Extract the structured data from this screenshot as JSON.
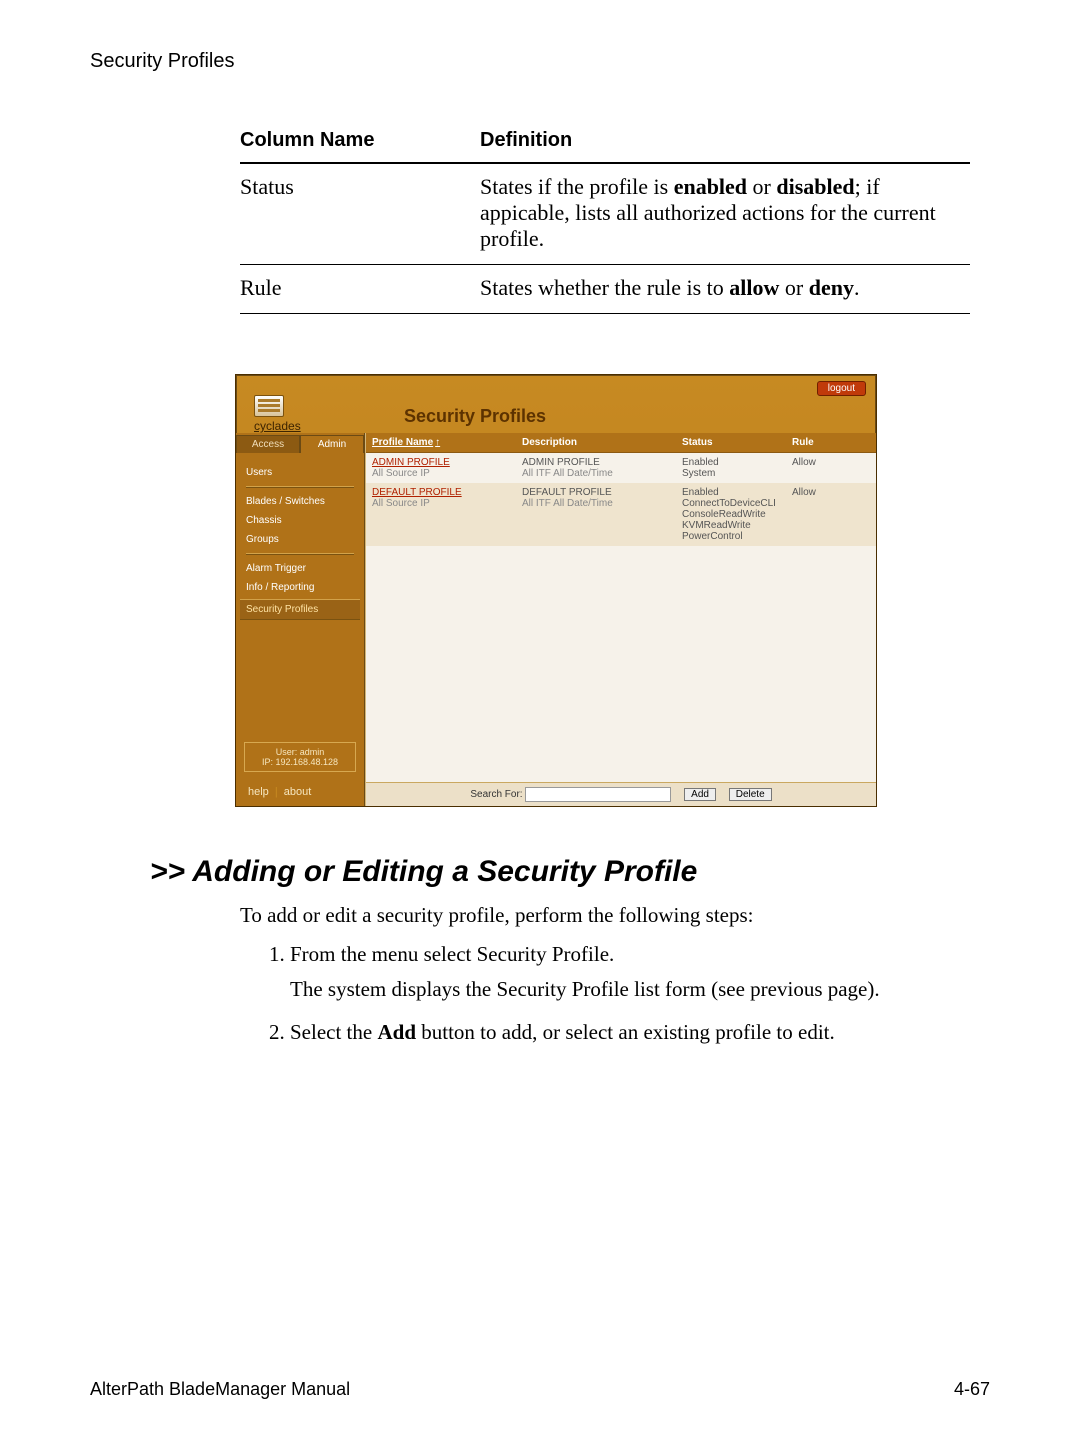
{
  "header": "Security Profiles",
  "def_table": {
    "columns": [
      "Column Name",
      "Definition"
    ],
    "rows": [
      {
        "name": "Status",
        "definition_pre": "States if the profile is ",
        "bold1": "enabled",
        "mid1": " or ",
        "bold2": "disabled",
        "definition_post": "; if appicable, lists all authorized actions for the current profile."
      },
      {
        "name": "Rule",
        "definition_pre": "States whether the rule is to ",
        "bold1": "allow",
        "mid1": " or ",
        "bold2": "deny",
        "definition_post": "."
      }
    ]
  },
  "app": {
    "logo_text": "cyclades",
    "title": "Security Profiles",
    "logout": "logout",
    "tabs": [
      "Access",
      "Admin"
    ],
    "side_items": [
      "Users",
      "Blades / Switches",
      "Chassis",
      "Groups",
      "Alarm Trigger",
      "Info / Reporting",
      "Security Profiles"
    ],
    "userbox_user": "User: admin",
    "userbox_ip": "IP: 192.168.48.128",
    "helpbar_help": "help",
    "helpbar_about": "about",
    "columns": [
      "Profile Name",
      "Description",
      "Status",
      "Rule"
    ],
    "sort_indicator": "↑",
    "rows": [
      {
        "profile_link": "ADMIN PROFILE",
        "profile_sub": "All Source IP",
        "desc_line1": "ADMIN PROFILE",
        "desc_line2": "All ITF      All Date/Time",
        "status": "Enabled\nSystem",
        "rule": "Allow"
      },
      {
        "profile_link": "DEFAULT PROFILE",
        "profile_sub": "All Source IP",
        "desc_line1": "DEFAULT PROFILE",
        "desc_line2": "All ITF      All Date/Time",
        "status": "Enabled\nConnectToDeviceCLI\nConsoleReadWrite\nKVMReadWrite\nPowerControl",
        "rule": "Allow"
      }
    ],
    "search_label": "Search For:",
    "search_value": "",
    "add_btn": "Add",
    "delete_btn": "Delete"
  },
  "section_heading": ">> Adding or Editing a Security Profile",
  "intro_text": "To add or edit a security profile, perform the following steps:",
  "steps": [
    {
      "main": "From the menu select Security Profile.",
      "sub": "The system displays the Security Profile list form (see previous page)."
    },
    {
      "pre": "Select the ",
      "bold": "Add",
      "post": " button to add, or select an existing profile to edit."
    }
  ],
  "footer_left": "AlterPath BladeManager Manual",
  "footer_right": "4-67"
}
